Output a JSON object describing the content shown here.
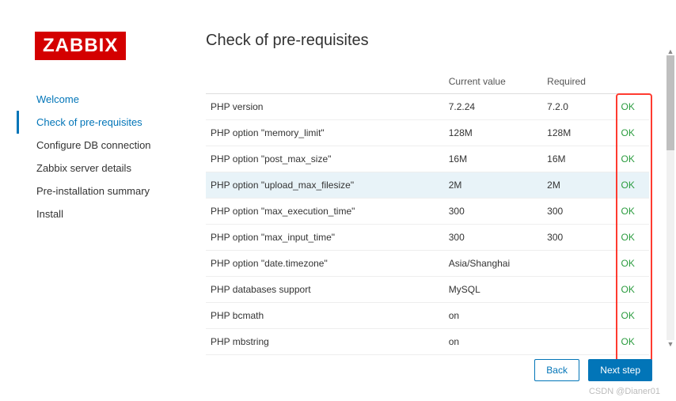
{
  "logo": "ZABBIX",
  "nav": {
    "items": [
      {
        "label": "Welcome",
        "link": true,
        "active": false
      },
      {
        "label": "Check of pre-requisites",
        "link": true,
        "active": true
      },
      {
        "label": "Configure DB connection",
        "link": false,
        "active": false
      },
      {
        "label": "Zabbix server details",
        "link": false,
        "active": false
      },
      {
        "label": "Pre-installation summary",
        "link": false,
        "active": false
      },
      {
        "label": "Install",
        "link": false,
        "active": false
      }
    ]
  },
  "title": "Check of pre-requisites",
  "table": {
    "headers": [
      "",
      "Current value",
      "Required",
      ""
    ],
    "rows": [
      {
        "name": "PHP version",
        "current": "7.2.24",
        "required": "7.2.0",
        "status": "OK",
        "hl": false
      },
      {
        "name": "PHP option \"memory_limit\"",
        "current": "128M",
        "required": "128M",
        "status": "OK",
        "hl": false
      },
      {
        "name": "PHP option \"post_max_size\"",
        "current": "16M",
        "required": "16M",
        "status": "OK",
        "hl": false
      },
      {
        "name": "PHP option \"upload_max_filesize\"",
        "current": "2M",
        "required": "2M",
        "status": "OK",
        "hl": true
      },
      {
        "name": "PHP option \"max_execution_time\"",
        "current": "300",
        "required": "300",
        "status": "OK",
        "hl": false
      },
      {
        "name": "PHP option \"max_input_time\"",
        "current": "300",
        "required": "300",
        "status": "OK",
        "hl": false
      },
      {
        "name": "PHP option \"date.timezone\"",
        "current": "Asia/Shanghai",
        "required": "",
        "status": "OK",
        "hl": false
      },
      {
        "name": "PHP databases support",
        "current": "MySQL",
        "required": "",
        "status": "OK",
        "hl": false
      },
      {
        "name": "PHP bcmath",
        "current": "on",
        "required": "",
        "status": "OK",
        "hl": false
      },
      {
        "name": "PHP mbstring",
        "current": "on",
        "required": "",
        "status": "OK",
        "hl": false
      }
    ]
  },
  "buttons": {
    "back": "Back",
    "next": "Next step"
  },
  "watermark": "CSDN @Dianer01"
}
